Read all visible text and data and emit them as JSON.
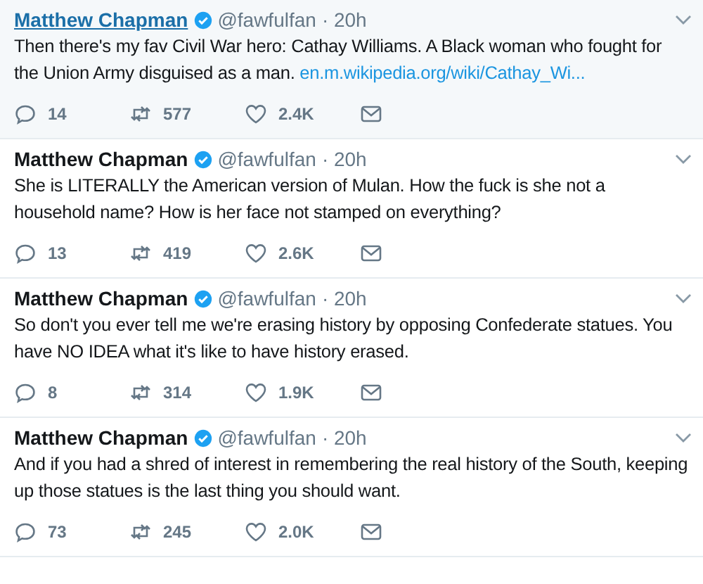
{
  "tweets": [
    {
      "name": "Matthew Chapman",
      "verified": true,
      "handle": "@fawfulfan",
      "time": "· 20h",
      "hovered": true,
      "text": "Then there's my fav Civil War hero: Cathay Williams. A Black woman who fought for the Union Army disguised as a man.",
      "link": "en.m.wikipedia.org/wiki/Cathay_Wi...",
      "replies": "14",
      "retweets": "577",
      "likes": "2.4K"
    },
    {
      "name": "Matthew Chapman",
      "verified": true,
      "handle": "@fawfulfan",
      "time": "· 20h",
      "hovered": false,
      "text": "She is LITERALLY the American version of Mulan. How the fuck is she not a household name? How is her face not stamped on everything?",
      "replies": "13",
      "retweets": "419",
      "likes": "2.6K"
    },
    {
      "name": "Matthew Chapman",
      "verified": true,
      "handle": "@fawfulfan",
      "time": "· 20h",
      "hovered": false,
      "text": "So don't you ever tell me we're erasing history by opposing Confederate statues. You have NO IDEA what it's like to have history erased.",
      "replies": "8",
      "retweets": "314",
      "likes": "1.9K"
    },
    {
      "name": "Matthew Chapman",
      "verified": true,
      "handle": "@fawfulfan",
      "time": "· 20h",
      "hovered": false,
      "text": "And if you had a shred of interest in remembering the real history of the South, keeping up those statues is the last thing you should want.",
      "replies": "73",
      "retweets": "245",
      "likes": "2.0K"
    }
  ]
}
